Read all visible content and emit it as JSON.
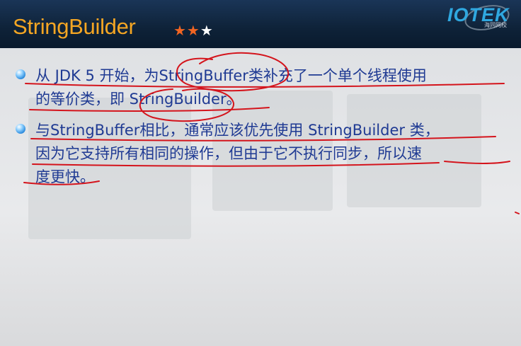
{
  "header": {
    "title": "StringBuilder",
    "rating": {
      "filled": "★★",
      "empty": "★"
    },
    "logo": {
      "brand": "IOTEK",
      "tagline": "海同网校"
    }
  },
  "bullets": [
    {
      "lines": [
        "从 JDK 5 开始，为StringBuffer类补充了一个单个线程使用",
        "的等价类，即 StringBuilder。"
      ]
    },
    {
      "lines": [
        "与StringBuffer相比，通常应该优先使用 StringBuilder 类，",
        "因为它支持所有相同的操作，但由于它不执行同步，所以速",
        "度更快。"
      ]
    }
  ],
  "colors": {
    "title": "#f5a623",
    "text": "#1f3a93",
    "ink": "#d4141c",
    "header_bg": "#0e2238"
  }
}
